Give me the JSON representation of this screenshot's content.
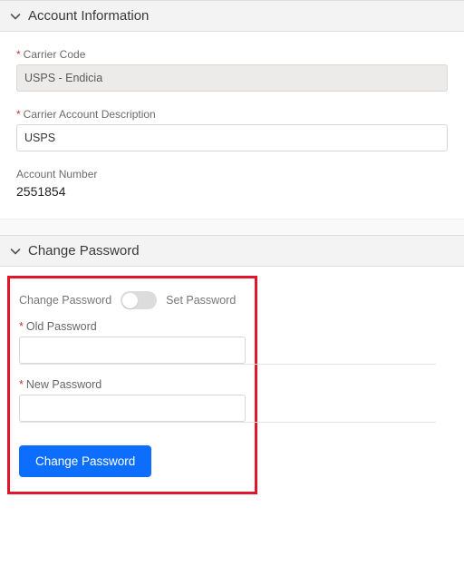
{
  "sections": {
    "account": {
      "title": "Account Information",
      "fields": {
        "carrierCode": {
          "label": "Carrier Code",
          "value": "USPS - Endicia",
          "required": true,
          "disabled": true
        },
        "carrierDesc": {
          "label": "Carrier Account Description",
          "value": "USPS",
          "required": true,
          "disabled": false
        },
        "accountNumber": {
          "label": "Account Number",
          "value": "2551854",
          "required": false
        }
      }
    },
    "changePassword": {
      "title": "Change Password",
      "toggle": {
        "leftLabel": "Change Password",
        "rightLabel": "Set Password"
      },
      "fields": {
        "oldPassword": {
          "label": "Old Password",
          "value": ""
        },
        "newPassword": {
          "label": "New Password",
          "value": ""
        }
      },
      "button": {
        "label": "Change Password"
      }
    }
  },
  "glyphs": {
    "requiredAsterisk": "*"
  }
}
